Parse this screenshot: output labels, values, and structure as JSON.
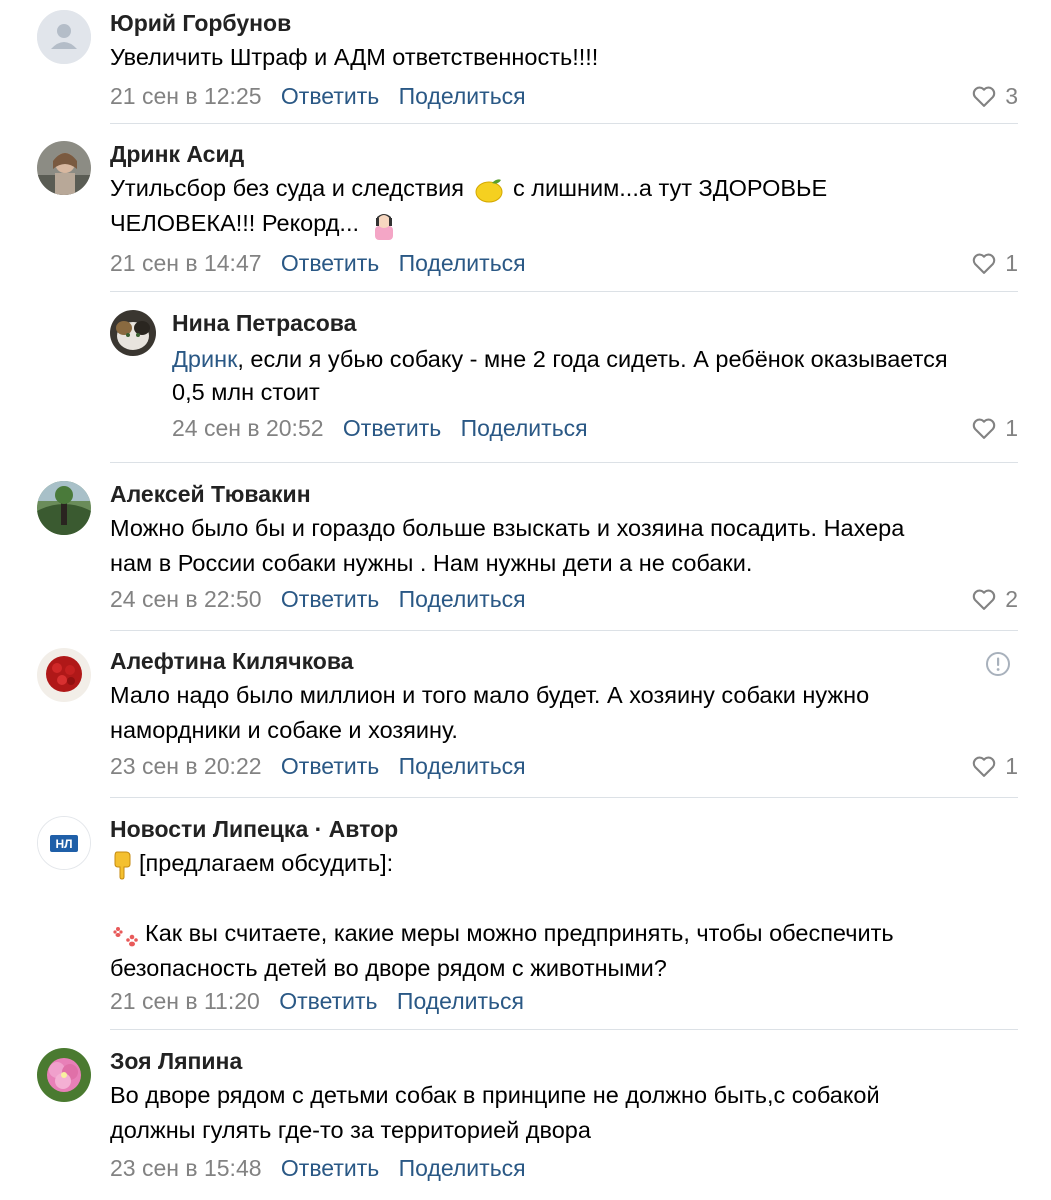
{
  "actions": {
    "reply": "Ответить",
    "share": "Поделиться"
  },
  "comments": [
    {
      "author": "Юрий Горбунов",
      "lines": [
        "Увеличить Штраф и АДМ ответственность!!!!"
      ],
      "date": "21 сен в 12:25",
      "likes": "3"
    },
    {
      "author": "Дринк Асид",
      "line1_a": "Утильсбор без суда и следствия",
      "line1_b": "с лишним...а тут ЗДОРОВЬЕ",
      "line2": "ЧЕЛОВЕКА!!! Рекорд...",
      "date": "21 сен в 14:47",
      "likes": "1"
    },
    {
      "author": "Нина Петрасова",
      "mention": "Дринк",
      "line1": ", если я убью собаку - мне 2 года сидеть. А ребёнок оказывается",
      "line2": "0,5 млн стоит",
      "date": "24 сен в 20:52",
      "likes": "1"
    },
    {
      "author": "Алексей Тювакин",
      "lines": [
        "Можно было бы и гораздо больше взыскать и хозяина посадить. Нахера",
        "нам в России собаки нужны . Нам нужны дети а не собаки."
      ],
      "date": "24 сен в 22:50",
      "likes": "2"
    },
    {
      "author": "Алефтина Килячкова",
      "lines": [
        "Мало надо было миллион и того мало будет. А хозяину собаки нужно",
        "намордники и собаке и хозяину."
      ],
      "date": "23 сен в 20:22",
      "likes": "1"
    },
    {
      "author": "Новости Липецка · Автор",
      "avatar_text": "НЛ",
      "line1": "[предлагаем обсудить]:",
      "line2": "Как вы считаете, какие меры можно предпринять, чтобы обеспечить",
      "line3": "безопасность детей во дворе рядом с животными?",
      "date": "21 сен в 11:20"
    },
    {
      "author": "Зоя Ляпина",
      "lines": [
        "Во дворе рядом с детьми собак в принципе не должно быть,с собакой",
        "должны гулять где-то за территорией двора"
      ],
      "date": "23 сен в 15:48"
    }
  ],
  "colors": {
    "link": "#2a5885",
    "meta": "#828282",
    "divider": "#dce1e6"
  },
  "icons": [
    "heart-icon",
    "report-icon",
    "lemon-emoji",
    "woman-gesture-emoji",
    "pointing-down-emoji",
    "paw-prints-emoji",
    "default-avatar-icon"
  ]
}
